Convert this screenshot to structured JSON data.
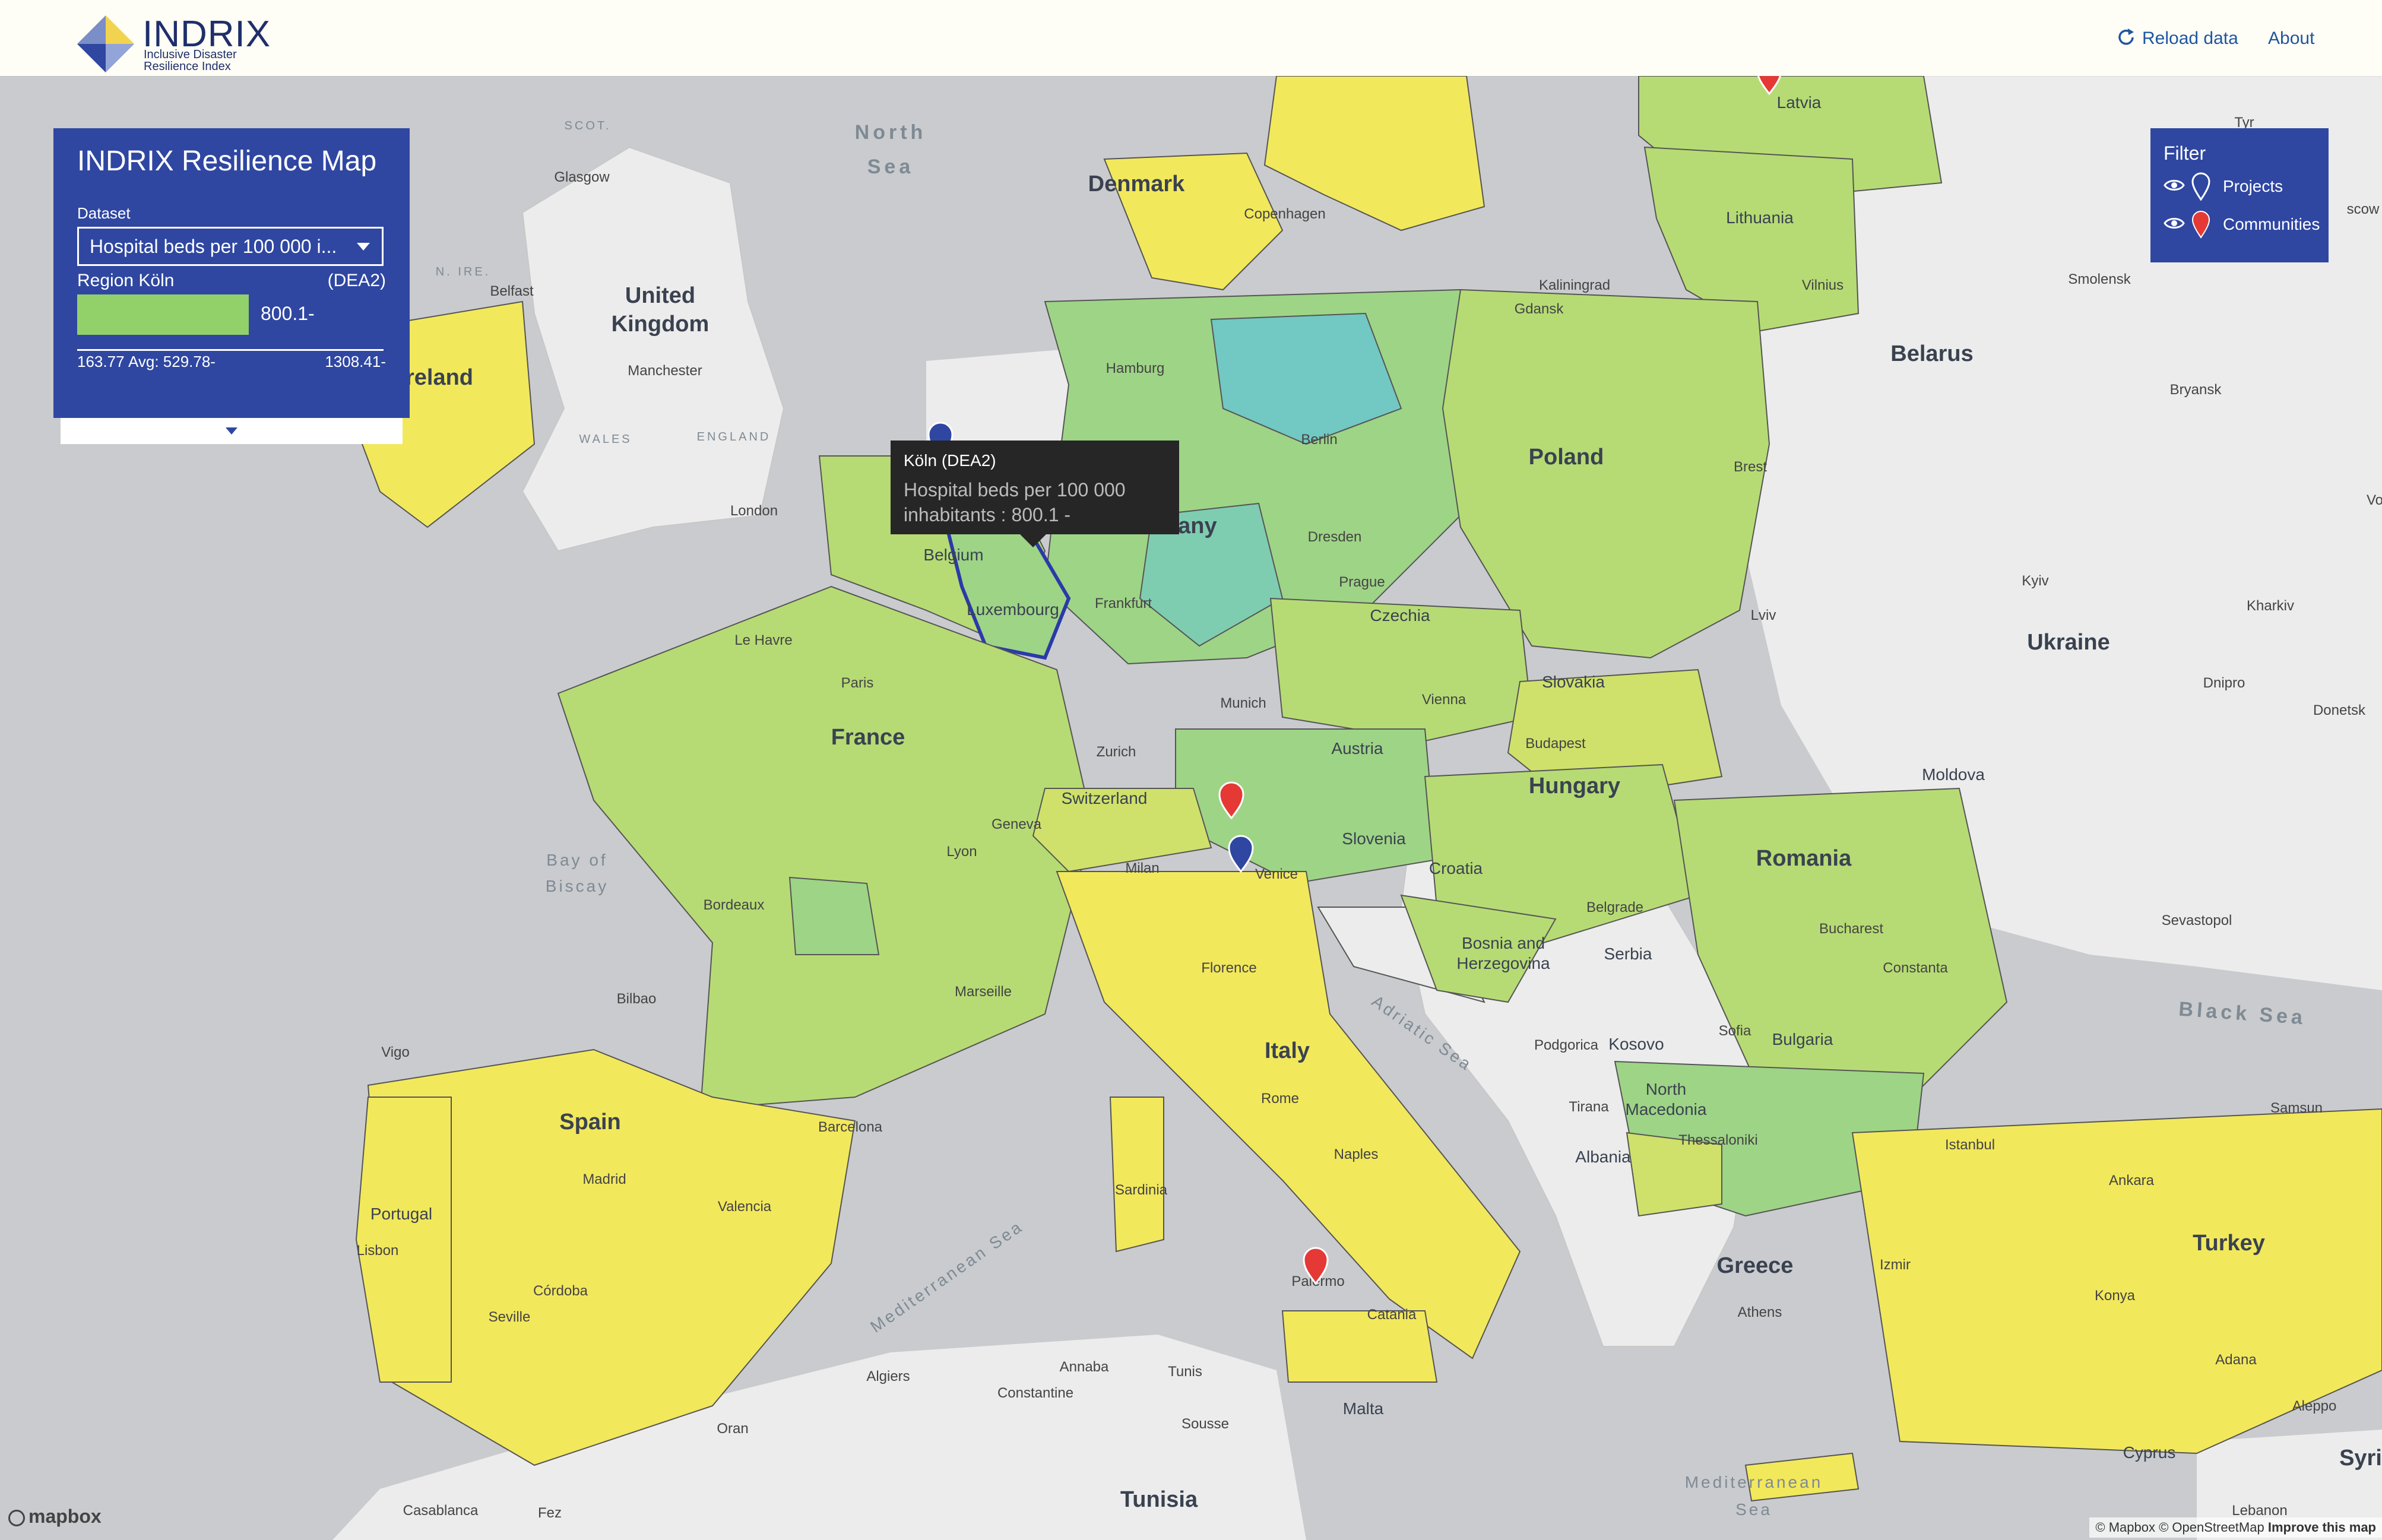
{
  "app": {
    "brand": "INDRIX",
    "tagline_line1": "Inclusive Disaster",
    "tagline_line2": "Resilience Index",
    "reload_label": "Reload data",
    "about_label": "About"
  },
  "panel": {
    "title": "INDRIX Resilience Map",
    "dataset_label": "Dataset",
    "dataset_value": "Hospital beds per 100 000 i...",
    "region_label": "Region Köln",
    "region_code": "(DEA2)",
    "bar_value": "800.1-",
    "bar_fraction": 0.56,
    "stat_min": "163.77",
    "stat_avg": "Avg: 529.78-",
    "stat_max": "1308.41-",
    "bar_color": "#92d16a"
  },
  "filter": {
    "title": "Filter",
    "items": [
      {
        "label": "Projects",
        "icon": "outline-pin-icon"
      },
      {
        "label": "Communities",
        "icon": "red-pin-icon"
      }
    ]
  },
  "tooltip": {
    "title": "Köln (DEA2)",
    "line1": "Hospital beds per 100 000",
    "line2": "inhabitants : 800.1 -"
  },
  "map": {
    "countries": [
      "Denmark",
      "Latvia",
      "Lithuania",
      "Belarus",
      "Poland",
      "Germany",
      "Belgium",
      "Luxembourg",
      "Czechia",
      "Slovakia",
      "Ukraine",
      "Moldova",
      "Austria",
      "Hungary",
      "Romania",
      "France",
      "Switzerland",
      "Slovenia",
      "Croatia",
      "Bosnia and",
      "Herzegovina",
      "Serbia",
      "Kosovo",
      "Bulgaria",
      "North",
      "Macedonia",
      "Albania",
      "Greece",
      "Italy",
      "Spain",
      "Portugal",
      "Turkey",
      "Tunisia",
      "United",
      "Kingdom",
      "Ireland",
      "Malta",
      "Cyprus",
      "Syri"
    ],
    "cities": [
      "Copenhagen",
      "Hamburg",
      "Berlin",
      "Kaliningrad",
      "Vilnius",
      "Gdansk",
      "Brest",
      "Smolensk",
      "Bryansk",
      "Dresden",
      "Prague",
      "Frankfurt",
      "Munich",
      "Vienna",
      "Budapest",
      "Lviv",
      "Kyiv",
      "Kharkiv",
      "Dnipro",
      "Donetsk",
      "Zurich",
      "Geneva",
      "Milan",
      "Venice",
      "Lyon",
      "Paris",
      "Le Havre",
      "Bordeaux",
      "Marseille",
      "Florence",
      "Rome",
      "Naples",
      "Belgrade",
      "Bucharest",
      "Constanta",
      "Sofia",
      "Podgorica",
      "Tirana",
      "Thessaloniki",
      "Athens",
      "Istanbul",
      "Izmir",
      "Ankara",
      "Samsun",
      "Konya",
      "Adana",
      "Aleppo",
      "Lebanon",
      "Bilbao",
      "Vigo",
      "Madrid",
      "Barcelona",
      "Valencia",
      "Lisbon",
      "Córdoba",
      "Seville",
      "Algiers",
      "Oran",
      "Casablanca",
      "Fez",
      "Annaba",
      "Constantine",
      "Tunis",
      "Sousse",
      "Palermo",
      "Catania",
      "Sardinia",
      "Sevastopol",
      "Glasgow",
      "Belfast",
      "Manchester",
      "London",
      "Lux",
      "Tyr",
      "scow",
      "Vo"
    ],
    "seas": [
      "North",
      "Sea",
      "Bay of",
      "Biscay",
      "Adriatic Sea",
      "Mediterranean Sea",
      "Black Sea",
      "Mediterranean",
      "Sea"
    ],
    "uk_regions": [
      "SCOT.",
      "WALES",
      "ENGLAND",
      "N. IRE."
    ],
    "colors": {
      "water": "#c9cbce",
      "land": "#ececec",
      "yellow": "#f2e85c",
      "yellowgreen": "#cfe16a",
      "lightgreen": "#b6db74",
      "green": "#9ed486",
      "teal": "#7fcdb0",
      "cyan": "#72c8c2",
      "selected": "#2b3aa8"
    }
  },
  "attribution": {
    "logo": "mapbox",
    "text": "© Mapbox © OpenStreetMap",
    "improve": "Improve this map"
  }
}
